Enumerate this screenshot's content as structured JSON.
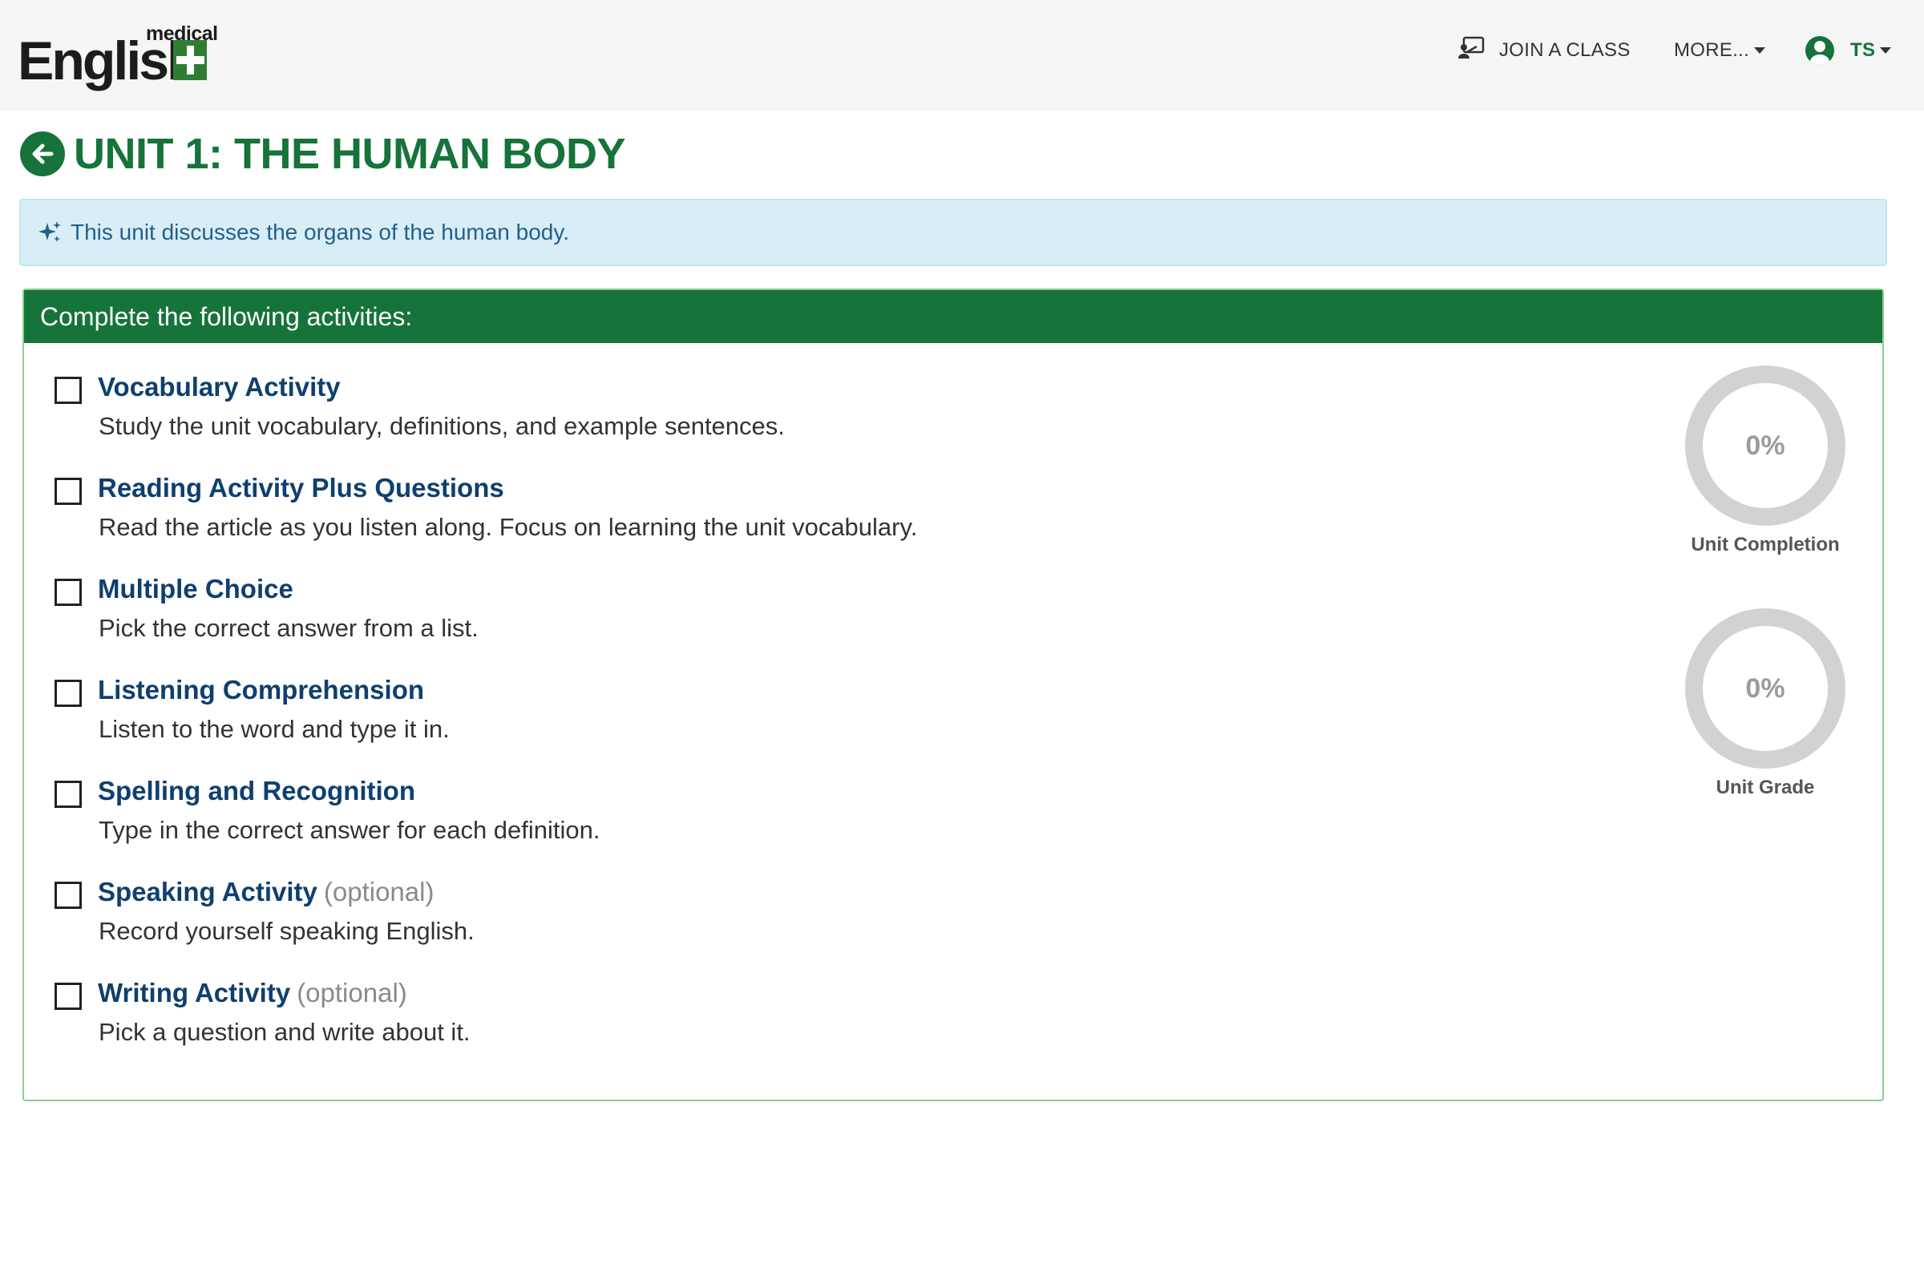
{
  "header": {
    "logo": {
      "top_text": "medical",
      "main_text": "English"
    },
    "nav": {
      "join_label": "JOIN A CLASS",
      "more_label": "MORE...",
      "user_initials": "TS"
    }
  },
  "unit": {
    "title": "UNIT 1: THE HUMAN BODY",
    "description": "This unit discusses the organs of the human body."
  },
  "panel": {
    "heading": "Complete the following activities:",
    "activities": [
      {
        "title": "Vocabulary Activity",
        "optional": "",
        "description": "Study the unit vocabulary, definitions, and example sentences."
      },
      {
        "title": "Reading Activity Plus Questions",
        "optional": "",
        "description": "Read the article as you listen along. Focus on learning the unit vocabulary."
      },
      {
        "title": "Multiple Choice",
        "optional": "",
        "description": "Pick the correct answer from a list."
      },
      {
        "title": "Listening Comprehension",
        "optional": "",
        "description": "Listen to the word and type it in."
      },
      {
        "title": "Spelling and Recognition",
        "optional": "",
        "description": "Type in the correct answer for each definition."
      },
      {
        "title": "Speaking Activity",
        "optional": "(optional)",
        "description": "Record yourself speaking English."
      },
      {
        "title": "Writing Activity",
        "optional": "(optional)",
        "description": "Pick a question and write about it."
      }
    ]
  },
  "gauges": {
    "completion": {
      "value": "0%",
      "label": "Unit Completion"
    },
    "grade": {
      "value": "0%",
      "label": "Unit Grade"
    }
  },
  "colors": {
    "brand_green": "#167339",
    "link_blue": "#0f3f6e",
    "alert_bg": "#d9edf7",
    "gauge_gray": "#d2d2d2"
  },
  "icons": {
    "back": "arrow-left-circle-icon",
    "join": "chalkboard-teacher-icon",
    "alert": "sparkle-icon",
    "user": "user-circle-icon",
    "logo": "medical-plus-icon"
  }
}
